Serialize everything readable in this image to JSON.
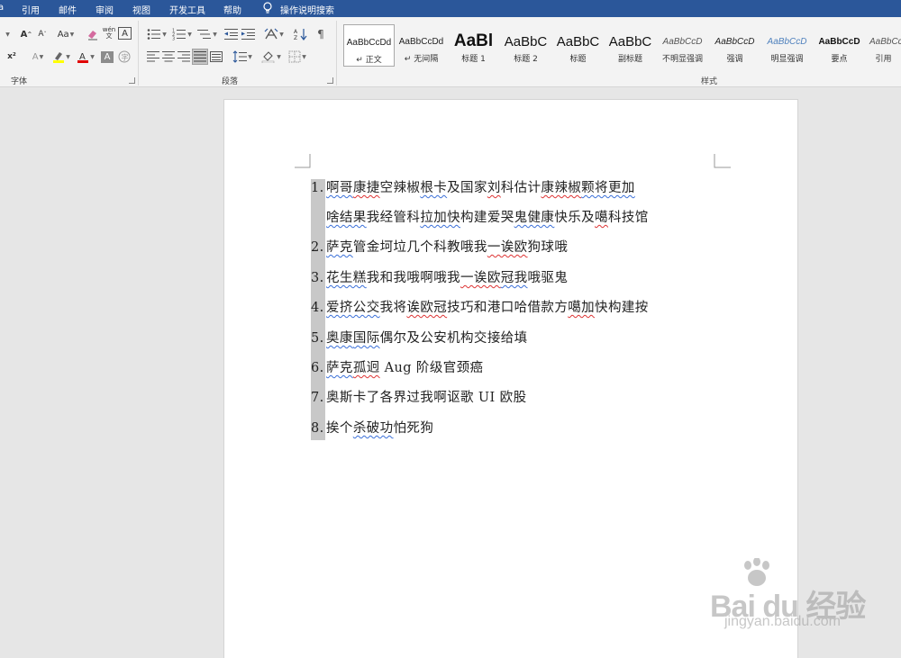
{
  "menu": {
    "items": [
      "引用",
      "邮件",
      "审阅",
      "视图",
      "开发工具",
      "帮助"
    ],
    "tell_me": "操作说明搜索"
  },
  "ribbon": {
    "groups": {
      "font": "字体",
      "paragraph": "段落",
      "styles": "样式"
    },
    "font_buttons": {
      "change_case": "Aa",
      "phonetic": "wén",
      "superscript": "x²"
    },
    "styles": [
      {
        "preview": "AaBbCcDd",
        "name": "↵ 正文"
      },
      {
        "preview": "AaBbCcDd",
        "name": "↵ 无间隔"
      },
      {
        "preview": "AaBl",
        "name": "标题 1"
      },
      {
        "preview": "AaBbC",
        "name": "标题 2"
      },
      {
        "preview": "AaBbC",
        "name": "标题"
      },
      {
        "preview": "AaBbC",
        "name": "副标题"
      },
      {
        "preview": "AaBbCcD",
        "name": "不明显强调"
      },
      {
        "preview": "AaBbCcD",
        "name": "强调"
      },
      {
        "preview": "AaBbCcD",
        "name": "明显强调"
      },
      {
        "preview": "AaBbCcD",
        "name": "要点"
      },
      {
        "preview": "AaBbCcD",
        "name": "引用"
      }
    ]
  },
  "document": {
    "lines": [
      {
        "num": "1.",
        "segs": [
          "啊哥",
          "康捷",
          "空辣椒",
          "根卡",
          "及国家",
          "刘",
          "科估计",
          "康辣椒",
          "颗将更加"
        ]
      },
      {
        "num": "",
        "segs": [
          "啥结果",
          "我经管科",
          "拉加快",
          "构建爱哭",
          "鬼健康",
          "快乐及",
          "噶",
          "科技馆"
        ]
      },
      {
        "num": "2.",
        "segs": [
          "萨克",
          "管金坷垃几个科教哦我",
          "一诶欧",
          "狗球哦"
        ]
      },
      {
        "num": "3.",
        "segs": [
          "花生糕",
          "我和我哦啊哦我",
          "一诶欧",
          "冠我",
          "哦驱鬼"
        ]
      },
      {
        "num": "4.",
        "segs": [
          "爱挤公交",
          "我将",
          "诶欧冠",
          "技巧和港口哈借款方",
          "噶加",
          "快构建按"
        ]
      },
      {
        "num": "5.",
        "segs": [
          "奥康",
          "国际",
          "偶尔及公安机构交接给填"
        ]
      },
      {
        "num": "6.",
        "segs": [
          "萨克",
          "孤迥",
          " Aug 阶级官颈癌"
        ]
      },
      {
        "num": "7.",
        "segs": [
          "奥斯卡了各界过我啊讴歌 UI 欧股"
        ]
      },
      {
        "num": "8.",
        "segs": [
          "挨个",
          "杀破功",
          "怕死狗"
        ]
      }
    ]
  },
  "watermark": {
    "logo": "Bai du 经验",
    "url": "jingyan.baidu.com"
  },
  "colors": {
    "title_bar": "#2b579a",
    "ribbon": "#f3f3f3",
    "canvas": "#e6e6e6",
    "spell_error": "#d33333",
    "grammar": "#3a6fd8"
  }
}
